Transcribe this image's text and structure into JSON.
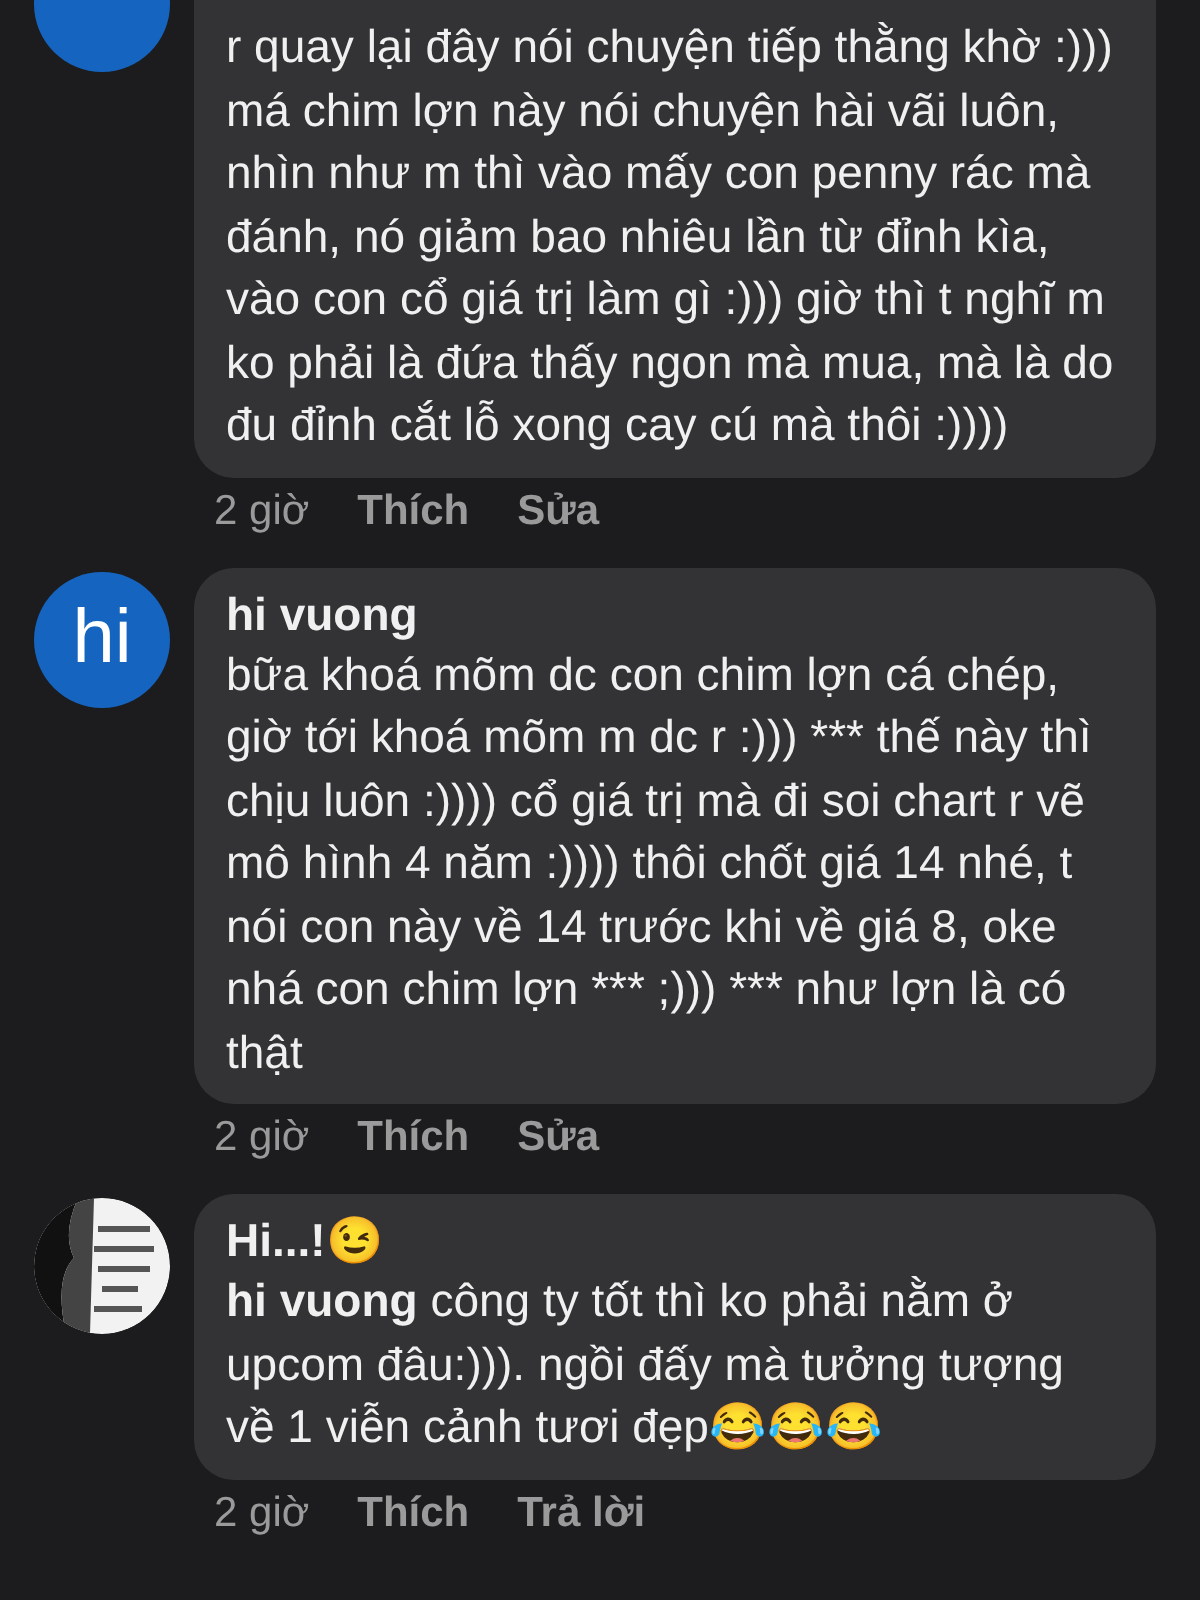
{
  "comments": [
    {
      "kind": "plain",
      "avatar": {
        "kind": "blank",
        "color": "#1565c0"
      },
      "body": "r quay lại đây nói chuyện tiếp thằng khờ :))) má chim lợn này nói chuyện hài vãi luôn, nhìn như m thì vào mấy con penny rác mà đánh, nó giảm bao nhiêu lần từ đỉnh kìa, vào con cổ giá trị làm gì :))) giờ thì t nghĩ m ko phải là đứa thấy ngon mà mua, mà là do đu đỉnh cắt lỗ xong cay cú mà thôi :))))",
      "time": "2 giờ",
      "like": "Thích",
      "action": "Sửa"
    },
    {
      "kind": "authored",
      "avatar": {
        "kind": "initials",
        "text": "hi",
        "color": "#1565c0"
      },
      "author": "hi vuong",
      "body": "bữa khoá mõm dc con chim lợn cá chép, giờ tới khoá mõm m dc r :))) *** thế này thì chịu luôn :)))) cổ giá trị mà đi soi chart r vẽ mô hình 4 năm :)))) thôi chốt giá 14 nhé, t nói con này về 14 trước khi về giá 8, oke nhá con chim lợn *** ;))) *** như lợn là có thật",
      "time": "2 giờ",
      "like": "Thích",
      "action": "Sửa"
    },
    {
      "kind": "reply",
      "author": "Hi...!😉",
      "body": "**hi vuong**  công ty tốt thì ko phải nằm ở upcom đâu:))). ngồi đấy mà tưởng tượng về 1 viễn cảnh tươi đẹp😂😂😂",
      "time": "2 giờ",
      "like": "Thích",
      "action": "Trả lời"
    }
  ]
}
